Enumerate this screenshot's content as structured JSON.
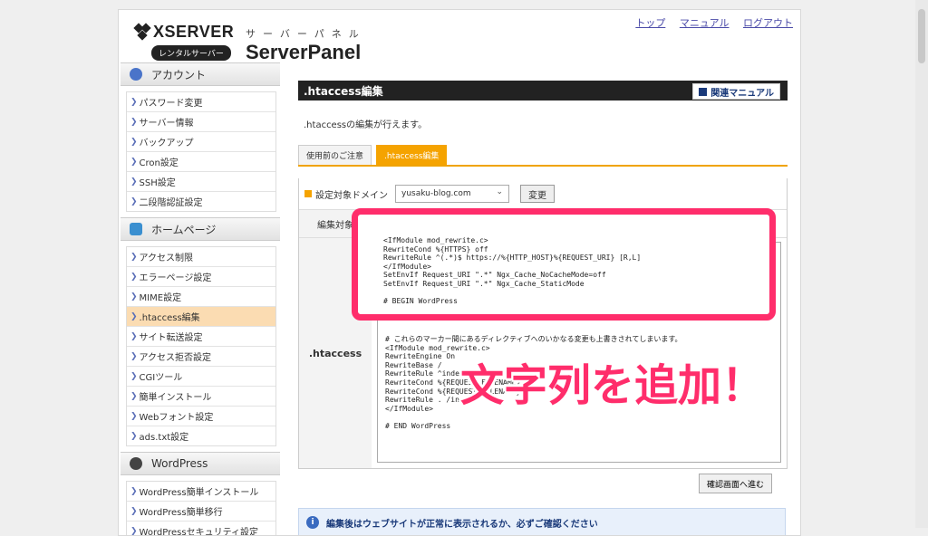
{
  "header": {
    "logo_brand": "XSERVER",
    "logo_sub": "レンタルサーバー",
    "panel_kana": "サーバーパネル",
    "panel_name": "ServerPanel",
    "links": [
      "トップ",
      "マニュアル",
      "ログアウト"
    ]
  },
  "sidebar": {
    "sections": [
      {
        "title": "アカウント",
        "icon": "user-icon",
        "items": [
          "パスワード変更",
          "サーバー情報",
          "バックアップ",
          "Cron設定",
          "SSH設定",
          "二段階認証設定"
        ]
      },
      {
        "title": "ホームページ",
        "icon": "homepage-icon",
        "items": [
          "アクセス制限",
          "エラーページ設定",
          "MIME設定",
          ".htaccess編集",
          "サイト転送設定",
          "アクセス拒否設定",
          "CGIツール",
          "簡単インストール",
          "Webフォント設定",
          "ads.txt設定"
        ]
      },
      {
        "title": "WordPress",
        "icon": "wordpress-icon",
        "items": [
          "WordPress簡単インストール",
          "WordPress簡単移行",
          "WordPressセキュリティ設定"
        ]
      }
    ],
    "active_item": ".htaccess編集"
  },
  "main": {
    "title": ".htaccess編集",
    "manual_button": "関連マニュアル",
    "description": ".htaccessの編集が行えます。",
    "tabs": [
      "使用前のご注意",
      ".htaccess編集"
    ],
    "domain_label": "設定対象ドメイン",
    "domain_value": "yusaku-blog.com",
    "change_button": "変更",
    "target_label": "編集対象",
    "htaccess_label": ".htaccess",
    "code": "\n\n\n\n\n\n\n\n\n\n# これらのマーカー間にあるディレクティブへのいかなる変更も上書きされてしまいます。\n<IfModule mod_rewrite.c>\nRewriteEngine On\nRewriteBase /\nRewriteRule ^index\nRewriteCond %{REQUEST_FILENAME}\nRewriteCond %{REQUEST_FILENAME}\nRewriteRule . /in\n</IfModule>\n\n# END WordPress",
    "confirm_button": "確認画面へ進む",
    "info_text": "編集後はウェブサイトが正常に表示されるか、必ずご確認ください"
  },
  "overlay": {
    "added_code": "<IfModule mod_rewrite.c>\nRewriteCond %{HTTPS} off\nRewriteRule ^(.*)$ https://%{HTTP_HOST}%{REQUEST_URI} [R,L]\n</IfModule>\nSetEnvIf Request_URI \".*\" Ngx_Cache_NoCacheMode=off\nSetEnvIf Request_URI \".*\" Ngx_Cache_StaticMode\n\n# BEGIN WordPress",
    "caption": "文字列を追加！",
    "accent_color": "#ff2d6b"
  }
}
